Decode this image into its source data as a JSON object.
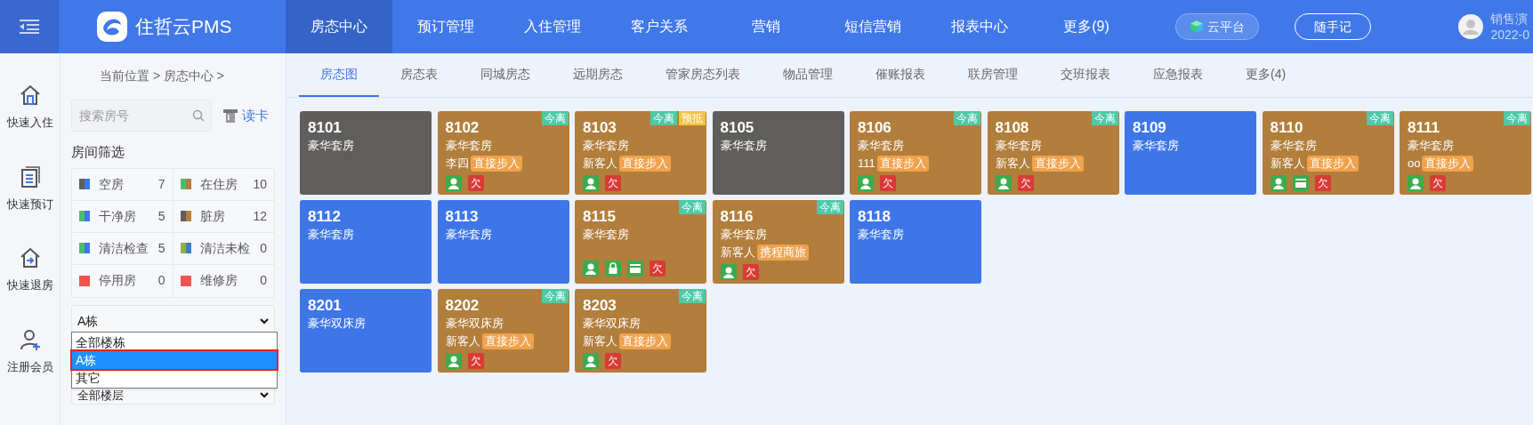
{
  "app": {
    "name": "住哲云PMS"
  },
  "nav": [
    {
      "label": "房态中心",
      "selected": true
    },
    {
      "label": "预订管理",
      "selected": false
    },
    {
      "label": "入住管理",
      "selected": false
    },
    {
      "label": "客户关系",
      "selected": false
    },
    {
      "label": "营销",
      "selected": false
    },
    {
      "label": "短信营销",
      "selected": false
    },
    {
      "label": "报表中心",
      "selected": false
    },
    {
      "label": "更多(9)",
      "selected": false
    }
  ],
  "cloud_button": "云平台",
  "notes_button": "随手记",
  "user": {
    "name": "销售演",
    "date": "2022-0"
  },
  "quick_actions": [
    {
      "kind": "checkin",
      "label": "快速入住"
    },
    {
      "kind": "booking",
      "label": "快速预订"
    },
    {
      "kind": "checkout",
      "label": "快速退房"
    },
    {
      "kind": "member",
      "label": "注册会员"
    }
  ],
  "breadcrumb": "当前位置 > 房态中心 >",
  "tabs": [
    {
      "label": "房态图",
      "selected": true
    },
    {
      "label": "房态表",
      "selected": false
    },
    {
      "label": "同城房态",
      "selected": false
    },
    {
      "label": "远期房态",
      "selected": false
    },
    {
      "label": "管家房态列表",
      "selected": false
    },
    {
      "label": "物品管理",
      "selected": false
    },
    {
      "label": "催账报表",
      "selected": false
    },
    {
      "label": "联房管理",
      "selected": false
    },
    {
      "label": "交班报表",
      "selected": false
    },
    {
      "label": "应急报表",
      "selected": false
    },
    {
      "label": "更多(4)",
      "selected": false
    }
  ],
  "search": {
    "placeholder": "搜索房号"
  },
  "read_card": "读卡",
  "filter_title": "房间筛选",
  "filters": [
    {
      "label": "空房",
      "count": "7",
      "swatch": [
        {
          "color": "#5f5e5c"
        },
        {
          "color": "#3e76e8"
        }
      ]
    },
    {
      "label": "在住房",
      "count": "10",
      "swatch": [
        {
          "color": "#4cbb6c"
        },
        {
          "color": "#b27e3b"
        }
      ]
    },
    {
      "label": "干净房",
      "count": "5",
      "swatch": [
        {
          "color": "#4cbb6c"
        },
        {
          "color": "#3e76e8"
        }
      ]
    },
    {
      "label": "脏房",
      "count": "12",
      "swatch": [
        {
          "color": "#5f5e5c"
        },
        {
          "color": "#b27e3b"
        }
      ]
    },
    {
      "label": "清洁检查",
      "count": "5",
      "swatch": [
        {
          "color": "#4cbb6c"
        },
        {
          "color": "#3e76e8"
        }
      ]
    },
    {
      "label": "清洁未检",
      "count": "0",
      "swatch": [
        {
          "color": "#8fb04a"
        },
        {
          "color": "#3d7fc4"
        }
      ]
    },
    {
      "label": "停用房",
      "count": "0",
      "swatch": [
        {
          "color": "#ef5350"
        }
      ]
    },
    {
      "label": "维修房",
      "count": "0",
      "swatch": [
        {
          "color": "#ef5350"
        }
      ]
    }
  ],
  "building_select": {
    "value": "A栋",
    "options": [
      {
        "label": "全部楼栋",
        "selected": false,
        "highlighted": false
      },
      {
        "label": "A栋",
        "selected": true,
        "highlighted": true
      },
      {
        "label": "其它",
        "selected": false,
        "highlighted": false
      }
    ]
  },
  "floor_select": {
    "value": "全部楼层"
  },
  "room_rows": [
    [
      {
        "room": "8101",
        "type": "豪华套房",
        "kind": "vacant-dirty"
      },
      {
        "room": "8102",
        "type": "豪华套房",
        "kind": "occupied",
        "tags": [
          {
            "kind": "leave",
            "text": "今离"
          }
        ],
        "guest": "李四",
        "source": "直接步入",
        "markers": [
          {
            "kind": "guest"
          },
          {
            "kind": "debt",
            "text": "欠"
          }
        ]
      },
      {
        "room": "8103",
        "type": "豪华套房",
        "kind": "occupied",
        "tags": [
          {
            "kind": "leave",
            "text": "今离"
          },
          {
            "kind": "arrive",
            "text": "预抵"
          }
        ],
        "guest": "新客人",
        "source": "直接步入",
        "markers": [
          {
            "kind": "guest"
          },
          {
            "kind": "debt",
            "text": "欠"
          }
        ]
      },
      {
        "room": "8105",
        "type": "豪华套房",
        "kind": "vacant-dirty"
      },
      {
        "room": "8106",
        "type": "豪华套房",
        "kind": "occupied",
        "tags": [
          {
            "kind": "leave",
            "text": "今离"
          }
        ],
        "guest": "111",
        "source": "直接步入",
        "markers": [
          {
            "kind": "guest"
          },
          {
            "kind": "debt",
            "text": "欠"
          }
        ]
      },
      {
        "room": "8108",
        "type": "豪华套房",
        "kind": "occupied",
        "tags": [
          {
            "kind": "leave",
            "text": "今离"
          }
        ],
        "guest": "新客人",
        "source": "直接步入",
        "markers": [
          {
            "kind": "guest"
          },
          {
            "kind": "debt",
            "text": "欠"
          }
        ]
      },
      {
        "room": "8109",
        "type": "豪华套房",
        "kind": "vacant-clean"
      },
      {
        "room": "8110",
        "type": "豪华套房",
        "kind": "occupied",
        "tags": [
          {
            "kind": "leave",
            "text": "今离"
          }
        ],
        "guest": "新客人",
        "source": "直接步入",
        "markers": [
          {
            "kind": "guest"
          },
          {
            "kind": "card"
          },
          {
            "kind": "debt",
            "text": "欠"
          }
        ]
      },
      {
        "room": "8111",
        "type": "豪华套房",
        "kind": "occupied",
        "tags": [
          {
            "kind": "leave",
            "text": "今离"
          }
        ],
        "guest": "oo",
        "source": "直接步入",
        "markers": [
          {
            "kind": "guest"
          },
          {
            "kind": "debt",
            "text": "欠"
          }
        ]
      }
    ],
    [
      {
        "room": "8112",
        "type": "豪华套房",
        "kind": "vacant-clean"
      },
      {
        "room": "8113",
        "type": "豪华套房",
        "kind": "vacant-clean"
      },
      {
        "room": "8115",
        "type": "豪华套房",
        "kind": "occupied",
        "tags": [
          {
            "kind": "leave",
            "text": "今离"
          }
        ],
        "markers": [
          {
            "kind": "guest"
          },
          {
            "kind": "lock"
          },
          {
            "kind": "card"
          },
          {
            "kind": "debt",
            "text": "欠"
          }
        ]
      },
      {
        "room": "8116",
        "type": "豪华套房",
        "kind": "occupied",
        "tags": [
          {
            "kind": "leave",
            "text": "今离"
          }
        ],
        "guest": "新客人",
        "source": "携程商旅",
        "markers": [
          {
            "kind": "guest"
          },
          {
            "kind": "debt",
            "text": "欠"
          }
        ]
      },
      {
        "room": "8118",
        "type": "豪华套房",
        "kind": "vacant-clean"
      }
    ],
    [
      {
        "room": "8201",
        "type": "豪华双床房",
        "kind": "vacant-clean"
      },
      {
        "room": "8202",
        "type": "豪华双床房",
        "kind": "occupied",
        "tags": [
          {
            "kind": "leave",
            "text": "今离"
          }
        ],
        "guest": "新客人",
        "source": "直接步入",
        "markers": [
          {
            "kind": "guest"
          },
          {
            "kind": "debt",
            "text": "欠"
          }
        ]
      },
      {
        "room": "8203",
        "type": "豪华双床房",
        "kind": "occupied",
        "tags": [
          {
            "kind": "leave",
            "text": "今离"
          }
        ],
        "guest": "新客人",
        "source": "直接步入",
        "markers": [
          {
            "kind": "guest"
          },
          {
            "kind": "debt",
            "text": "欠"
          }
        ]
      }
    ]
  ]
}
